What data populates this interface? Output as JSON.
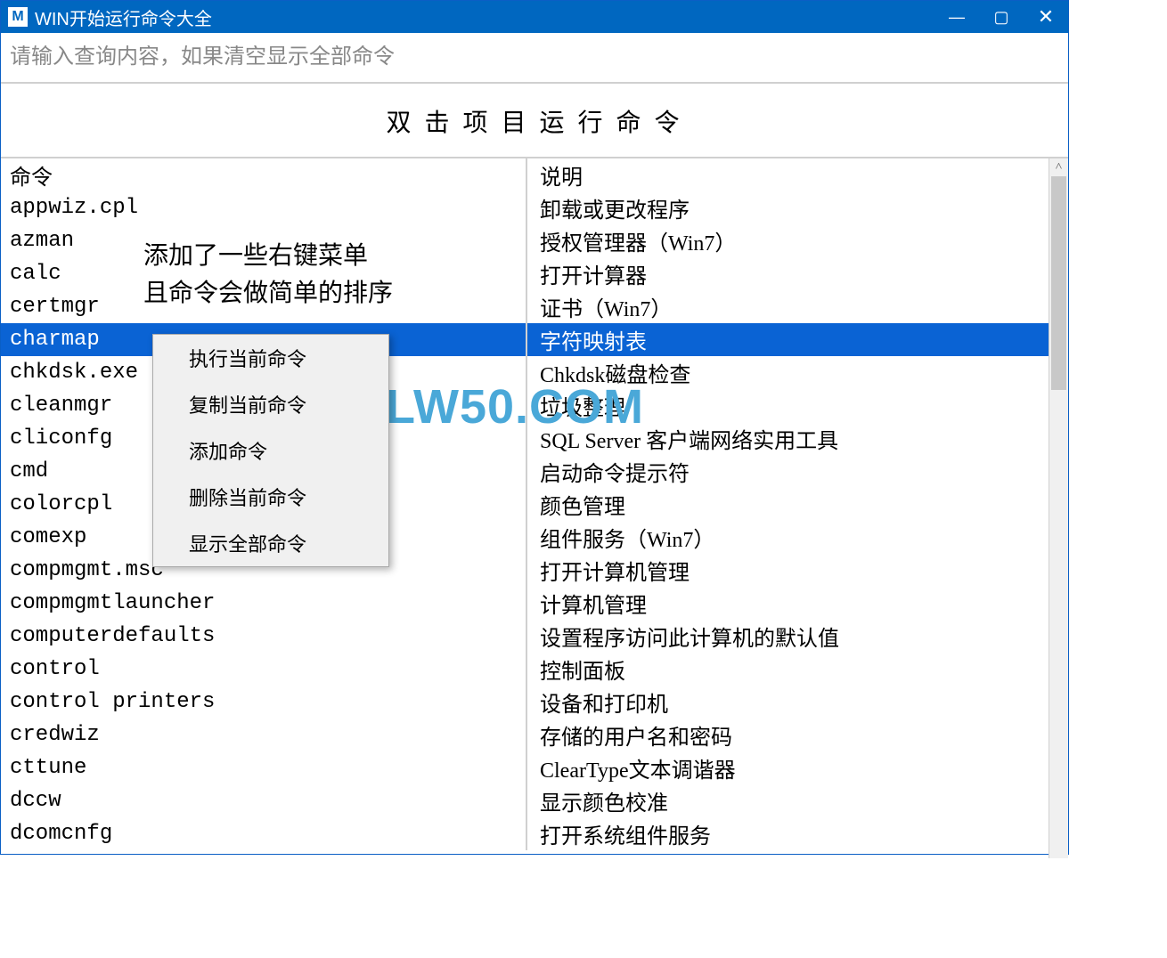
{
  "titlebar": {
    "icon_letter": "M",
    "title": "WIN开始运行命令大全"
  },
  "search": {
    "placeholder": "请输入查询内容，如果清空显示全部命令"
  },
  "banner": "双 击 项 目 运 行 命 令",
  "columns": {
    "cmd": "命令",
    "desc": "说明"
  },
  "rows": [
    {
      "cmd": "appwiz.cpl",
      "desc": "卸载或更改程序"
    },
    {
      "cmd": "azman",
      "desc": "授权管理器（Win7）"
    },
    {
      "cmd": "calc",
      "desc": "打开计算器"
    },
    {
      "cmd": "certmgr",
      "desc": "证书（Win7）"
    },
    {
      "cmd": "charmap",
      "desc": "字符映射表",
      "selected": true
    },
    {
      "cmd": "chkdsk.exe",
      "desc": "Chkdsk磁盘检查"
    },
    {
      "cmd": "cleanmgr",
      "desc": "垃圾整理"
    },
    {
      "cmd": "cliconfg",
      "desc": "SQL Server 客户端网络实用工具"
    },
    {
      "cmd": "cmd",
      "desc": "启动命令提示符"
    },
    {
      "cmd": "colorcpl",
      "desc": "颜色管理"
    },
    {
      "cmd": "comexp",
      "desc": "组件服务（Win7）"
    },
    {
      "cmd": "compmgmt.msc",
      "desc": "打开计算机管理"
    },
    {
      "cmd": "compmgmtlauncher",
      "desc": "计算机管理"
    },
    {
      "cmd": "computerdefaults",
      "desc": "设置程序访问此计算机的默认值"
    },
    {
      "cmd": "control",
      "desc": "控制面板"
    },
    {
      "cmd": "control printers",
      "desc": "设备和打印机"
    },
    {
      "cmd": "credwiz",
      "desc": "存储的用户名和密码"
    },
    {
      "cmd": "cttune",
      "desc": "ClearType文本调谐器"
    },
    {
      "cmd": "dccw",
      "desc": "显示颜色校准"
    },
    {
      "cmd": "dcomcnfg",
      "desc": "打开系统组件服务"
    }
  ],
  "annotation": {
    "line1": "添加了一些右键菜单",
    "line2": "且命令会做简单的排序"
  },
  "context_menu": [
    "执行当前命令",
    "复制当前命令",
    "添加命令",
    "删除当前命令",
    "显示全部命令"
  ],
  "watermark": "LW50.COM"
}
